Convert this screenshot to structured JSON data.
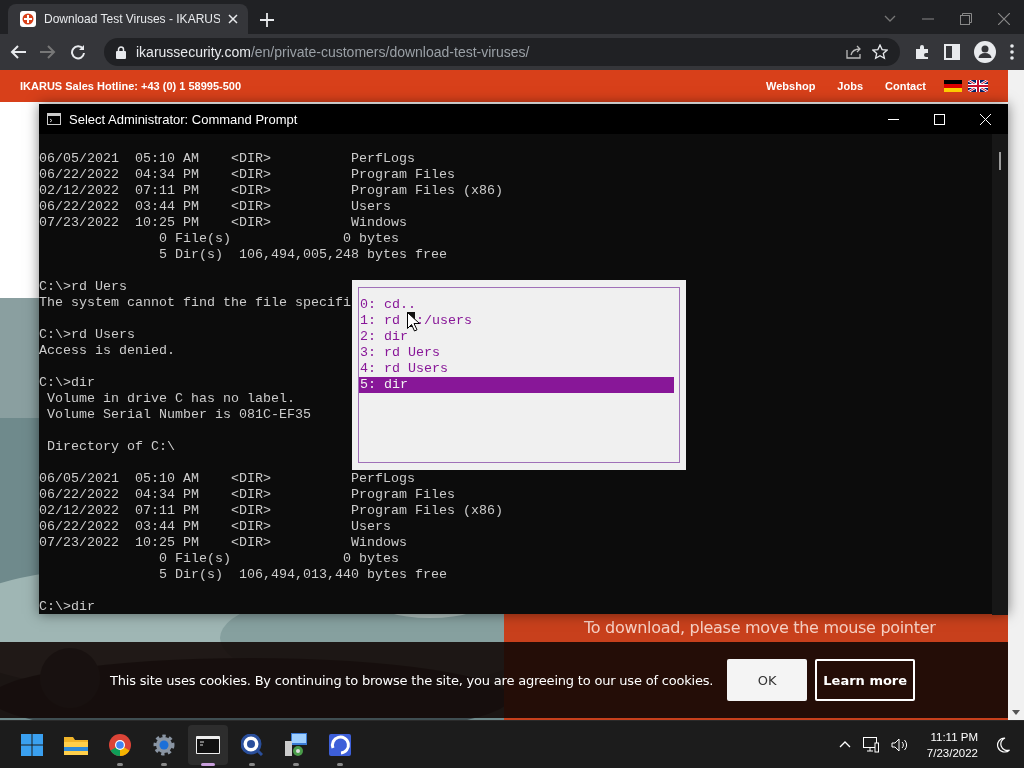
{
  "browser": {
    "tab_title": "Download Test Viruses - IKARUS",
    "url_host": "ikarussecurity.com",
    "url_path": "/en/private-customers/download-test-viruses/"
  },
  "site_header": {
    "hotline": "IKARUS Sales Hotline: +43 (0) 1 58995-500",
    "links": [
      "Webshop",
      "Jobs",
      "Contact"
    ]
  },
  "page": {
    "panel_text": "To download, please move the mouse pointer"
  },
  "console": {
    "title": "Select Administrator: Command Prompt",
    "blocks": [
      [
        "06/05/2021  05:10 AM    <DIR>          PerfLogs",
        "06/22/2022  04:34 PM    <DIR>          Program Files",
        "02/12/2022  07:11 PM    <DIR>          Program Files (x86)",
        "06/22/2022  03:44 PM    <DIR>          Users",
        "07/23/2022  10:25 PM    <DIR>          Windows",
        "               0 File(s)              0 bytes",
        "               5 Dir(s)  106,494,005,248 bytes free"
      ],
      [
        "C:\\>rd Uers",
        "The system cannot find the file specifi"
      ],
      [
        "C:\\>rd Users",
        "Access is denied."
      ],
      [
        "C:\\>dir",
        " Volume in drive C has no label.",
        " Volume Serial Number is 081C-EF35"
      ],
      [
        " Directory of C:\\"
      ],
      [
        "06/05/2021  05:10 AM    <DIR>          PerfLogs",
        "06/22/2022  04:34 PM    <DIR>          Program Files",
        "02/12/2022  07:11 PM    <DIR>          Program Files (x86)",
        "06/22/2022  03:44 PM    <DIR>          Users",
        "07/23/2022  10:25 PM    <DIR>          Windows",
        "               0 File(s)              0 bytes",
        "               5 Dir(s)  106,494,013,440 bytes free"
      ],
      [
        "C:\\>dir"
      ]
    ],
    "history_popup": {
      "items": [
        {
          "text": "0: cd..",
          "selected": false
        },
        {
          "text": "1: rd  :/users",
          "selected": false
        },
        {
          "text": "2: dir",
          "selected": false
        },
        {
          "text": "3: rd Uers",
          "selected": false
        },
        {
          "text": "4: rd Users",
          "selected": false
        },
        {
          "text": "5: dir",
          "selected": true
        }
      ]
    }
  },
  "cookie_bar": {
    "message": "This site uses cookies. By continuing to browse the site, you are agreeing to our use of cookies.",
    "buttons": [
      {
        "label": "OK",
        "kind": "filled"
      },
      {
        "label": "Learn more",
        "kind": "outlined"
      }
    ]
  },
  "taskbar": {
    "apps": [
      {
        "kind": "start",
        "running": false,
        "selected": false
      },
      {
        "kind": "folder",
        "running": false,
        "selected": false
      },
      {
        "kind": "browser",
        "running": true,
        "selected": false
      },
      {
        "kind": "settings",
        "running": true,
        "selected": false
      },
      {
        "kind": "terminal",
        "running": true,
        "selected": true
      },
      {
        "kind": "magnifier",
        "running": true,
        "selected": false
      },
      {
        "kind": "computer",
        "running": true,
        "selected": false
      },
      {
        "kind": "remote",
        "running": true,
        "selected": false
      }
    ],
    "time": "11:11 PM",
    "date": "7/23/2022"
  }
}
